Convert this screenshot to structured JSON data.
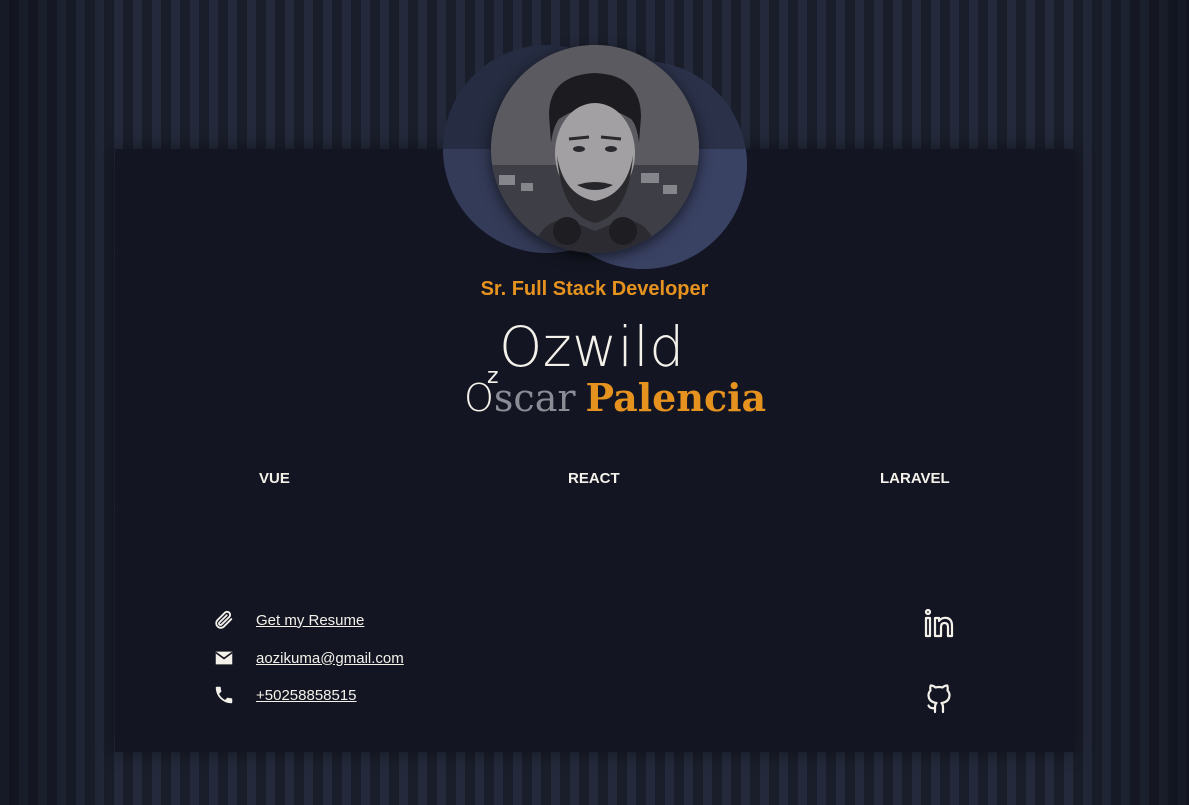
{
  "profile": {
    "title": "Sr. Full Stack Developer",
    "nickname": "Ozwild",
    "first_name_initial": "O",
    "first_name_rest": "scar",
    "last_name": "Palencia",
    "nickname_accent": "z"
  },
  "skills": [
    "VUE",
    "REACT",
    "LARAVEL"
  ],
  "contacts": [
    {
      "icon": "paperclip-icon",
      "label": "Get my Resume"
    },
    {
      "icon": "mail-icon",
      "label": "aozikuma@gmail.com"
    },
    {
      "icon": "phone-icon",
      "label": "+50258858515"
    }
  ],
  "social": [
    {
      "icon": "linkedin-icon"
    },
    {
      "icon": "github-icon"
    }
  ],
  "colors": {
    "accent": "#e6921f",
    "text": "#f4f1ea",
    "card": "#131622",
    "background": "#1a1e2c"
  }
}
